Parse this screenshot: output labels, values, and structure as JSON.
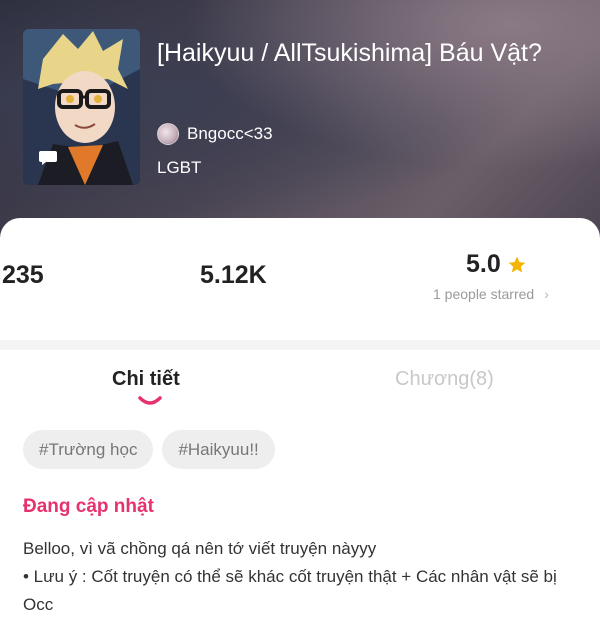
{
  "story": {
    "title": "[Haikyuu / AllTsukishima] Báu Vật?",
    "author": "Bngocc<33",
    "genre": "LGBT"
  },
  "stats": {
    "reads": "235",
    "votes": "5.12K",
    "rating": "5.0",
    "starred_text": "1 people starred"
  },
  "tabs": {
    "details": "Chi tiết",
    "chapters": "Chương(8)"
  },
  "tags": [
    "#Trường học",
    "#Haikyuu!!"
  ],
  "status": "Đang cập nhật",
  "description": [
    "Belloo, vì vã chồng qá nên tớ viết truyện nàyyy",
    "• Lưu ý : Cốt truyện có thể sẽ khác cốt truyện thật + Các nhân vật sẽ bị Occ"
  ],
  "icons": {
    "star": "star-icon",
    "chevron": "chevron-right-icon",
    "chat": "chat-bubble-icon"
  },
  "colors": {
    "accent": "#e6326e",
    "star": "#f5b400",
    "inactive_tab": "#c8c8c8"
  }
}
